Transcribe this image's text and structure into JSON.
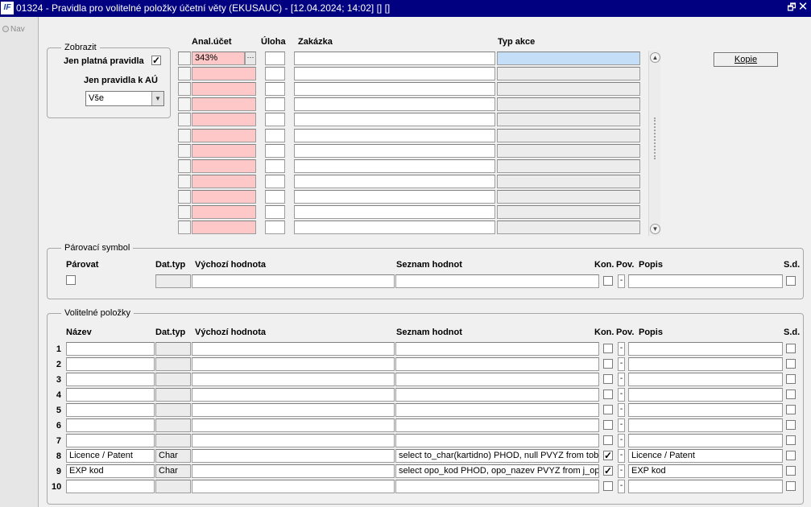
{
  "window": {
    "title": "01324 - Pravidla pro volitelné položky účetní věty (EKUSAUC) - [12.04.2024; 14:02]  [] []",
    "app_icon": "IF",
    "restore_glyph": "🗗",
    "close_glyph": "✕"
  },
  "nav": {
    "label": "Nav"
  },
  "zobrazit": {
    "group_label": "Zobrazit",
    "jen_platna_label": "Jen platná pravidla",
    "jen_platna_checked": true,
    "jen_au_label": "Jen pravidla k AÚ",
    "jen_au_value": "Vše"
  },
  "rules": {
    "headers": {
      "anal_ucet": "Anal.účet",
      "uloha": "Úloha",
      "zakazka": "Zakázka",
      "typ_akce": "Typ akce"
    },
    "rows": [
      {
        "anal_ucet": "343%",
        "uloha": "",
        "zakazka": "",
        "typ_akce": ""
      },
      {
        "anal_ucet": "",
        "uloha": "",
        "zakazka": "",
        "typ_akce": ""
      },
      {
        "anal_ucet": "",
        "uloha": "",
        "zakazka": "",
        "typ_akce": ""
      },
      {
        "anal_ucet": "",
        "uloha": "",
        "zakazka": "",
        "typ_akce": ""
      },
      {
        "anal_ucet": "",
        "uloha": "",
        "zakazka": "",
        "typ_akce": ""
      },
      {
        "anal_ucet": "",
        "uloha": "",
        "zakazka": "",
        "typ_akce": ""
      },
      {
        "anal_ucet": "",
        "uloha": "",
        "zakazka": "",
        "typ_akce": ""
      },
      {
        "anal_ucet": "",
        "uloha": "",
        "zakazka": "",
        "typ_akce": ""
      },
      {
        "anal_ucet": "",
        "uloha": "",
        "zakazka": "",
        "typ_akce": ""
      },
      {
        "anal_ucet": "",
        "uloha": "",
        "zakazka": "",
        "typ_akce": ""
      },
      {
        "anal_ucet": "",
        "uloha": "",
        "zakazka": "",
        "typ_akce": ""
      },
      {
        "anal_ucet": "",
        "uloha": "",
        "zakazka": "",
        "typ_akce": ""
      }
    ],
    "lov_glyph": "···",
    "scroll_up": "▲",
    "scroll_down": "▼"
  },
  "kopie_button": {
    "label": "Kopie"
  },
  "parovaci": {
    "group_label": "Párovací symbol",
    "headers": {
      "parovat": "Párovat",
      "dat_typ": "Dat.typ",
      "vychozi": "Výchozí hodnota",
      "seznam": "Seznam hodnot",
      "kon": "Kon.",
      "pov": "Pov.",
      "popis": "Popis",
      "sd": "S.d."
    },
    "row": {
      "parovat": false,
      "dat_typ": "",
      "vychozi": "",
      "seznam": "",
      "kon": false,
      "pov": "-",
      "popis": "",
      "sd": false
    }
  },
  "volitelne": {
    "group_label": "Volitelné položky",
    "headers": {
      "nazev": "Název",
      "dat_typ": "Dat.typ",
      "vychozi": "Výchozí hodnota",
      "seznam": "Seznam hodnot",
      "kon": "Kon.",
      "pov": "Pov.",
      "popis": "Popis",
      "sd": "S.d."
    },
    "rows": [
      {
        "num": "1",
        "nazev": "",
        "dat_typ": "",
        "vychozi": "",
        "seznam": "",
        "kon": false,
        "pov": "-",
        "popis": "",
        "sd": false
      },
      {
        "num": "2",
        "nazev": "",
        "dat_typ": "",
        "vychozi": "",
        "seznam": "",
        "kon": false,
        "pov": "-",
        "popis": "",
        "sd": false
      },
      {
        "num": "3",
        "nazev": "",
        "dat_typ": "",
        "vychozi": "",
        "seznam": "",
        "kon": false,
        "pov": "-",
        "popis": "",
        "sd": false
      },
      {
        "num": "4",
        "nazev": "",
        "dat_typ": "",
        "vychozi": "",
        "seznam": "",
        "kon": false,
        "pov": "-",
        "popis": "",
        "sd": false
      },
      {
        "num": "5",
        "nazev": "",
        "dat_typ": "",
        "vychozi": "",
        "seznam": "",
        "kon": false,
        "pov": "-",
        "popis": "",
        "sd": false
      },
      {
        "num": "6",
        "nazev": "",
        "dat_typ": "",
        "vychozi": "",
        "seznam": "",
        "kon": false,
        "pov": "-",
        "popis": "",
        "sd": false
      },
      {
        "num": "7",
        "nazev": "",
        "dat_typ": "",
        "vychozi": "",
        "seznam": "",
        "kon": false,
        "pov": "-",
        "popis": "",
        "sd": false
      },
      {
        "num": "8",
        "nazev": "Licence / Patent",
        "dat_typ": "Char",
        "vychozi": "",
        "seznam": "select  to_char(kartidno) PHOD, null PVYZ  from tobo",
        "kon": true,
        "pov": "-",
        "popis": "Licence / Patent",
        "sd": false
      },
      {
        "num": "9",
        "nazev": "EXP kod",
        "dat_typ": "Char",
        "vychozi": "",
        "seznam": "select opo_kod PHOD, opo_nazev PVYZ   from j_op",
        "kon": true,
        "pov": "-",
        "popis": "EXP kod",
        "sd": false
      },
      {
        "num": "10",
        "nazev": "",
        "dat_typ": "",
        "vychozi": "",
        "seznam": "",
        "kon": false,
        "pov": "-",
        "popis": "",
        "sd": false
      }
    ]
  },
  "colors": {
    "titlebar": "#000080",
    "required_field": "#ffc8c8",
    "current_record": "#c4def8",
    "window_bg": "#f0f0f0"
  }
}
